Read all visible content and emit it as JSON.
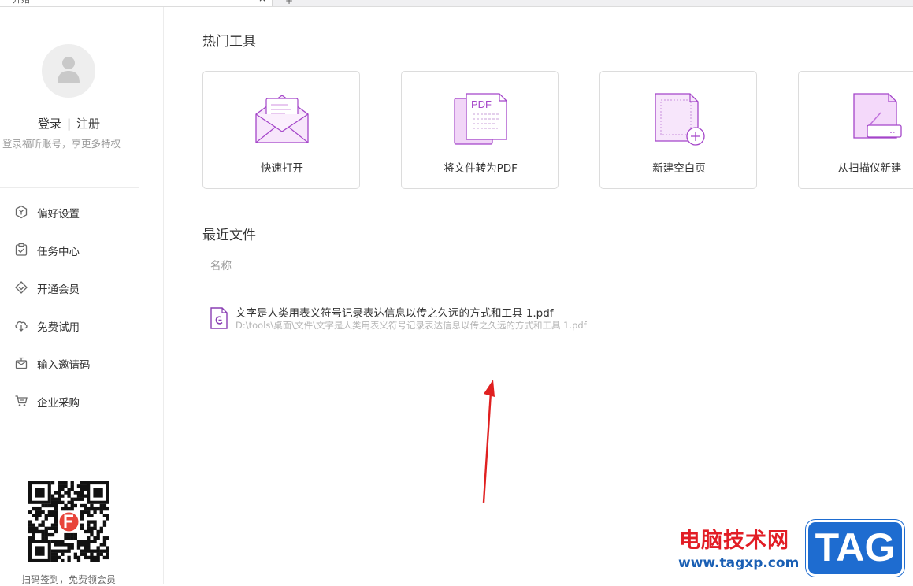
{
  "tab": {
    "title": "开始",
    "close_glyph": "×",
    "add_glyph": "+"
  },
  "sidebar": {
    "login_label": "登录",
    "separator": "|",
    "register_label": "注册",
    "login_hint": "登录福昕账号，享更多特权",
    "items": [
      {
        "label": "偏好设置",
        "icon": "preferences-icon"
      },
      {
        "label": "任务中心",
        "icon": "task-center-icon"
      },
      {
        "label": "开通会员",
        "icon": "vip-icon"
      },
      {
        "label": "免费试用",
        "icon": "free-trial-icon"
      },
      {
        "label": "输入邀请码",
        "icon": "invite-code-icon"
      },
      {
        "label": "企业采购",
        "icon": "enterprise-purchase-icon"
      }
    ],
    "qr_caption": "扫码签到，免费领会员"
  },
  "main": {
    "hot_tools_title": "热门工具",
    "tools": [
      {
        "label": "快速打开",
        "icon": "quick-open-icon"
      },
      {
        "label": "将文件转为PDF",
        "icon": "convert-to-pdf-icon",
        "badge": "PDF"
      },
      {
        "label": "新建空白页",
        "icon": "new-blank-page-icon"
      },
      {
        "label": "从扫描仪新建",
        "icon": "scanner-new-icon"
      }
    ],
    "recent_title": "最近文件",
    "column_name": "名称",
    "files": [
      {
        "name": "文字是人类用表义符号记录表达信息以传之久远的方式和工具 1.pdf",
        "path": "D:\\tools\\桌面\\文件\\文字是人类用表义符号记录表达信息以传之久远的方式和工具 1.pdf"
      }
    ]
  },
  "watermark": {
    "site_name": "电脑技术网",
    "url": "www.tagxp.com",
    "logo_text": "TAG"
  },
  "colors": {
    "accent_purple": "#a445c9",
    "annotation_arrow": "#e02020",
    "watermark_red": "#e21d25",
    "watermark_blue": "#1e6cd0"
  }
}
